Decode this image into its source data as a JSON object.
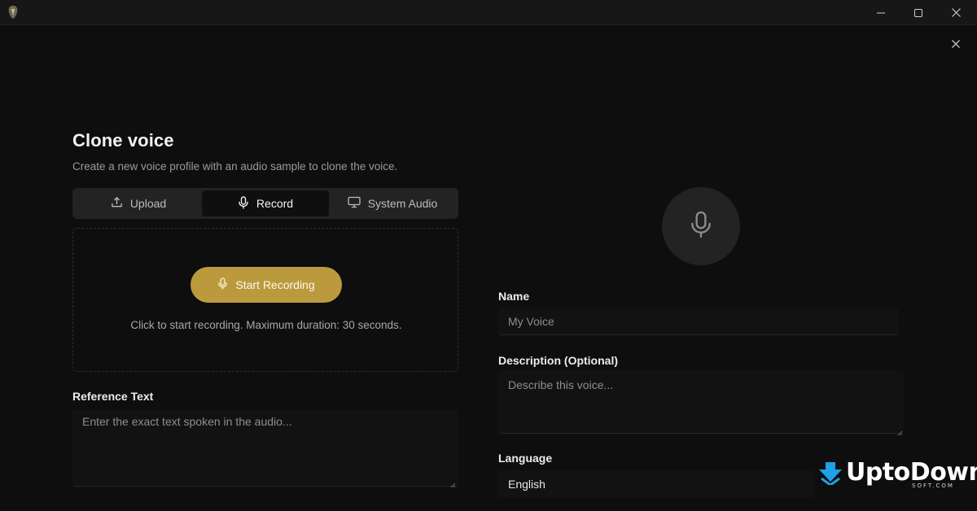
{
  "window": {
    "title_icon": "app-logo-icon"
  },
  "dialog": {
    "title": "Clone voice",
    "subtitle": "Create a new voice profile with an audio sample to clone the voice."
  },
  "tabs": [
    {
      "label": "Upload",
      "icon": "upload-icon",
      "active": false
    },
    {
      "label": "Record",
      "icon": "microphone-icon",
      "active": true
    },
    {
      "label": "System Audio",
      "icon": "monitor-icon",
      "active": false
    }
  ],
  "record": {
    "button_label": "Start Recording",
    "hint": "Click to start recording. Maximum duration: 30 seconds."
  },
  "reference": {
    "label": "Reference Text",
    "placeholder": "Enter the exact text spoken in the audio..."
  },
  "profile": {
    "name_label": "Name",
    "name_placeholder": "My Voice",
    "description_label": "Description (Optional)",
    "description_placeholder": "Describe this voice...",
    "language_label": "Language",
    "language_value": "English"
  },
  "watermark": {
    "text": "UptoDown",
    "subtext": "SOFT.COM"
  },
  "colors": {
    "accent": "#bb9a3e",
    "background": "#0e0e0e",
    "panel": "#232323"
  }
}
